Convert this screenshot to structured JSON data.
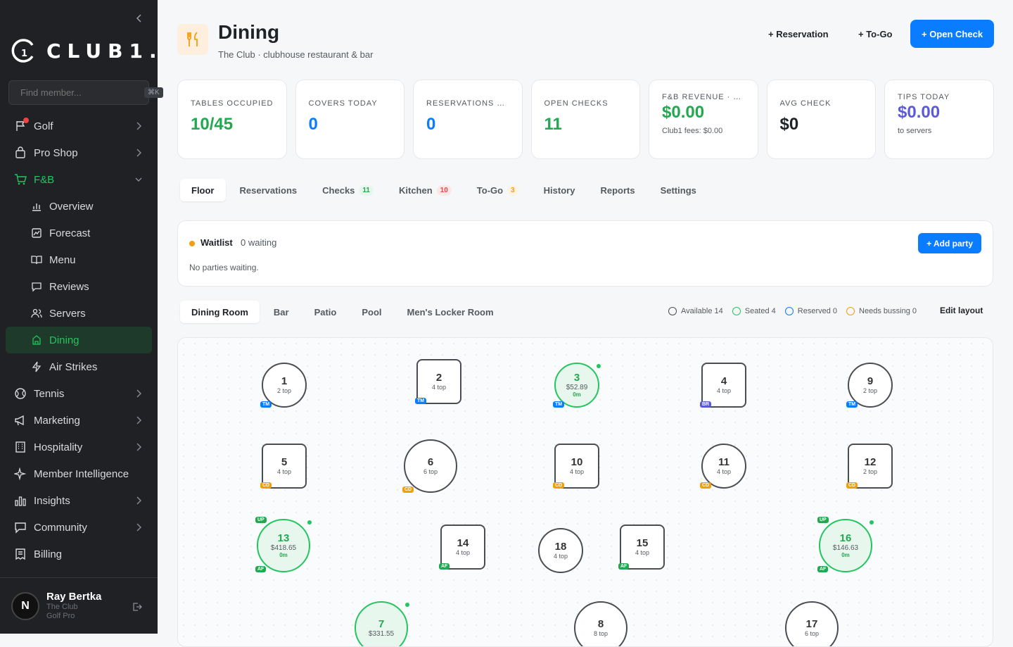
{
  "sidebar": {
    "brand": "CLUB1.",
    "search": {
      "placeholder": "Find member...",
      "shortcut": "⌘K"
    },
    "items": [
      {
        "label": "Golf",
        "icon": "flag-icon"
      },
      {
        "label": "Pro Shop",
        "icon": "bag-icon"
      },
      {
        "label": "F&B",
        "icon": "cart-icon"
      },
      {
        "label": "Tennis",
        "icon": "tennis-icon"
      },
      {
        "label": "Marketing",
        "icon": "megaphone-icon"
      },
      {
        "label": "Hospitality",
        "icon": "building-icon"
      },
      {
        "label": "Member Intelligence",
        "icon": "sparkle-icon"
      },
      {
        "label": "Insights",
        "icon": "bar-chart-icon"
      },
      {
        "label": "Community",
        "icon": "chat-icon"
      },
      {
        "label": "Billing",
        "icon": "receipt-icon"
      }
    ],
    "fb_sub": [
      {
        "label": "Overview"
      },
      {
        "label": "Forecast"
      },
      {
        "label": "Menu"
      },
      {
        "label": "Reviews"
      },
      {
        "label": "Servers"
      },
      {
        "label": "Dining"
      },
      {
        "label": "Air Strikes"
      }
    ],
    "user": {
      "initial": "N",
      "name": "Ray Bertka",
      "club": "The Club",
      "role": "Golf Pro"
    }
  },
  "header": {
    "title": "Dining",
    "subtitle": "The Club · clubhouse restaurant & bar",
    "reservation_btn": "+ Reservation",
    "togo_btn": "+ To-Go",
    "open_check_btn": "+ Open Check"
  },
  "stats": [
    {
      "label": "TABLES OCCUPIED",
      "value": "10/45",
      "note": "",
      "color": "#22a84f"
    },
    {
      "label": "COVERS TODAY",
      "value": "0",
      "note": "",
      "color": "#0a7cff"
    },
    {
      "label": "RESERVATIONS TODAY",
      "value": "0",
      "note": "",
      "color": "#0a7cff"
    },
    {
      "label": "OPEN CHECKS",
      "value": "11",
      "note": "",
      "color": "#22a84f"
    },
    {
      "label": "F&B REVENUE · TODAY",
      "value": "$0.00",
      "note": "Club1 fees: $0.00",
      "color": "#22a84f"
    },
    {
      "label": "AVG CHECK",
      "value": "$0",
      "note": "",
      "color": "#1f2328"
    },
    {
      "label": "TIPS TODAY",
      "value": "$0.00",
      "note": "to servers",
      "color": "#5b5bd6"
    }
  ],
  "tabs": [
    {
      "label": "Floor",
      "badge": ""
    },
    {
      "label": "Reservations",
      "badge": ""
    },
    {
      "label": "Checks",
      "badge": "11"
    },
    {
      "label": "Kitchen",
      "badge": "10"
    },
    {
      "label": "To-Go",
      "badge": "3"
    },
    {
      "label": "History",
      "badge": ""
    },
    {
      "label": "Reports",
      "badge": ""
    },
    {
      "label": "Settings",
      "badge": ""
    }
  ],
  "waitlist": {
    "title": "Waitlist",
    "count": "0 waiting",
    "empty": "No parties waiting.",
    "add_btn": "+ Add party"
  },
  "rooms": [
    "Dining Room",
    "Bar",
    "Patio",
    "Pool",
    "Men's Locker Room"
  ],
  "legend": [
    {
      "label": "Available 14",
      "color": "#4a4e54"
    },
    {
      "label": "Seated 4",
      "color": "#22c55e"
    },
    {
      "label": "Reserved 0",
      "color": "#0a7cff"
    },
    {
      "label": "Needs bussing 0",
      "color": "#f59e0b"
    }
  ],
  "edit_layout": "Edit layout",
  "tables": [
    {
      "num": "1",
      "cap": "2 top",
      "shape": "round",
      "status": "available",
      "server": "TM",
      "amount": "",
      "time": "",
      "extra": ""
    },
    {
      "num": "2",
      "cap": "4 top",
      "shape": "square",
      "status": "available",
      "server": "TM",
      "amount": "",
      "time": "",
      "extra": ""
    },
    {
      "num": "3",
      "cap": "",
      "shape": "round",
      "status": "seated",
      "server": "TM",
      "amount": "$52.89",
      "time": "0m",
      "extra": ""
    },
    {
      "num": "4",
      "cap": "4 top",
      "shape": "square",
      "status": "available",
      "server": "BR",
      "amount": "",
      "time": "",
      "extra": ""
    },
    {
      "num": "9",
      "cap": "2 top",
      "shape": "round",
      "status": "available",
      "server": "TM",
      "amount": "",
      "time": "",
      "extra": ""
    },
    {
      "num": "5",
      "cap": "4 top",
      "shape": "square",
      "status": "available",
      "server": "CD",
      "amount": "",
      "time": "",
      "extra": ""
    },
    {
      "num": "6",
      "cap": "6 top",
      "shape": "round",
      "status": "available",
      "server": "CD",
      "amount": "",
      "time": "",
      "extra": ""
    },
    {
      "num": "10",
      "cap": "4 top",
      "shape": "square",
      "status": "available",
      "server": "CD",
      "amount": "",
      "time": "",
      "extra": ""
    },
    {
      "num": "11",
      "cap": "4 top",
      "shape": "round",
      "status": "available",
      "server": "CD",
      "amount": "",
      "time": "",
      "extra": ""
    },
    {
      "num": "12",
      "cap": "2 top",
      "shape": "square",
      "status": "available",
      "server": "CD",
      "amount": "",
      "time": "",
      "extra": ""
    },
    {
      "num": "13",
      "cap": "",
      "shape": "round",
      "status": "seated",
      "server": "AF",
      "amount": "$418.65",
      "time": "0m",
      "extra": "UP"
    },
    {
      "num": "14",
      "cap": "4 top",
      "shape": "square",
      "status": "available",
      "server": "AF",
      "amount": "",
      "time": "",
      "extra": ""
    },
    {
      "num": "18",
      "cap": "4 top",
      "shape": "round",
      "status": "available",
      "server": "",
      "amount": "",
      "time": "",
      "extra": ""
    },
    {
      "num": "15",
      "cap": "4 top",
      "shape": "square",
      "status": "available",
      "server": "AF",
      "amount": "",
      "time": "",
      "extra": ""
    },
    {
      "num": "16",
      "cap": "",
      "shape": "round",
      "status": "seated",
      "server": "AF",
      "amount": "$146.63",
      "time": "0m",
      "extra": "UP"
    },
    {
      "num": "7",
      "cap": "",
      "shape": "round",
      "status": "seated",
      "server": "",
      "amount": "$331.55",
      "time": "",
      "extra": ""
    },
    {
      "num": "8",
      "cap": "8 top",
      "shape": "round",
      "status": "available",
      "server": "",
      "amount": "",
      "time": "",
      "extra": ""
    },
    {
      "num": "17",
      "cap": "6 top",
      "shape": "round",
      "status": "available",
      "server": "",
      "amount": "",
      "time": "",
      "extra": ""
    }
  ],
  "server_colors": {
    "TM": "#0a7cff",
    "BR": "#5b5bd6",
    "CD": "#f59e0b",
    "AF": "#22a84f",
    "UP": "#22a84f"
  }
}
